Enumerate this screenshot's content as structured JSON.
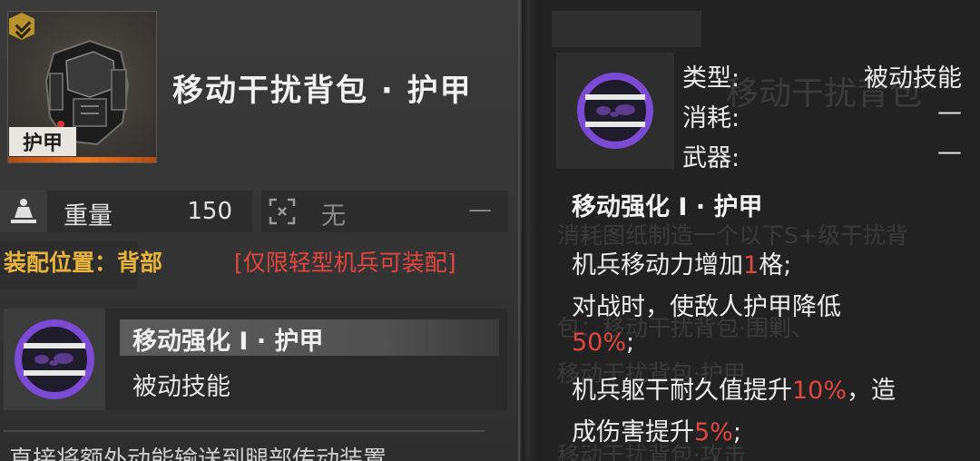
{
  "item": {
    "title": "移动干扰背包 · 护甲",
    "type_tag": "护甲",
    "rank_icon": "double-chevron-rank-icon",
    "accent_color": "#f07a22"
  },
  "stats": {
    "weight_label": "重量",
    "weight_value": "150",
    "slot_label": "无",
    "slot_value": "—"
  },
  "equip": {
    "position_label": "装配位置：背部",
    "restriction": "[仅限轻型机兵可装配]"
  },
  "skill": {
    "name": "移动强化 I · 护甲",
    "type": "被动技能",
    "icon": "purple-ring-skill-icon"
  },
  "description_partial": "直接将额外动能输送到腿部传动装置",
  "detail": {
    "rows": [
      {
        "label": "类型:",
        "value": "被动技能"
      },
      {
        "label": "消耗:",
        "value": "—"
      },
      {
        "label": "武器:",
        "value": "—"
      }
    ],
    "skill_title": "移动强化 I · 护甲",
    "lines": [
      {
        "pre": "机兵移动力增加",
        "hl": "1",
        "post": "格;"
      },
      {
        "pre": "对战时，使敌人护甲降低",
        "hl": "",
        "post": ""
      },
      {
        "pre": "",
        "hl": "50%",
        "post": ";"
      },
      {
        "pre": "机兵躯干耐久值提升",
        "hl": "10%",
        "post": "，造"
      },
      {
        "pre": "成伤害提升",
        "hl": "5%",
        "post": ";"
      }
    ],
    "highlight_color": "#e2473f"
  },
  "ghost": {
    "title": "移动干扰背包",
    "lines": [
      "消耗图纸制造一个以下S+级干扰背",
      "包：移动干扰背包·围剿、",
      "移动干扰背包·护甲、",
      "移动干扰背包·攻击"
    ]
  }
}
